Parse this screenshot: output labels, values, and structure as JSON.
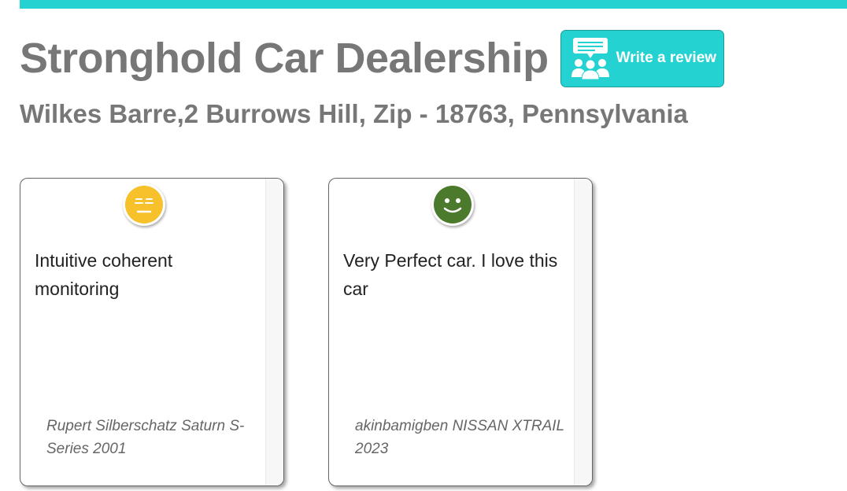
{
  "header": {
    "dealer_name": "Stronghold Car Dealership",
    "review_button_label": "Write a review",
    "review_button_icon": "group-chat-icon",
    "address": "Wilkes Barre,2 Burrows Hill, Zip - 18763, Pennsylvania"
  },
  "colors": {
    "accent": "#25d2d2",
    "neutral_sentiment": "#f6c12a",
    "positive_sentiment": "#4b7a2c"
  },
  "reviews": [
    {
      "sentiment": "neutral",
      "sentiment_icon": "neutral-face-icon",
      "text": "Intuitive coherent monitoring",
      "author_line": "Rupert Silberschatz Saturn S-Series 2001"
    },
    {
      "sentiment": "positive",
      "sentiment_icon": "smiling-face-icon",
      "text": "Very Perfect car. I love this car",
      "author_line": "akinbamigben NISSAN XTRAIL 2023"
    }
  ]
}
